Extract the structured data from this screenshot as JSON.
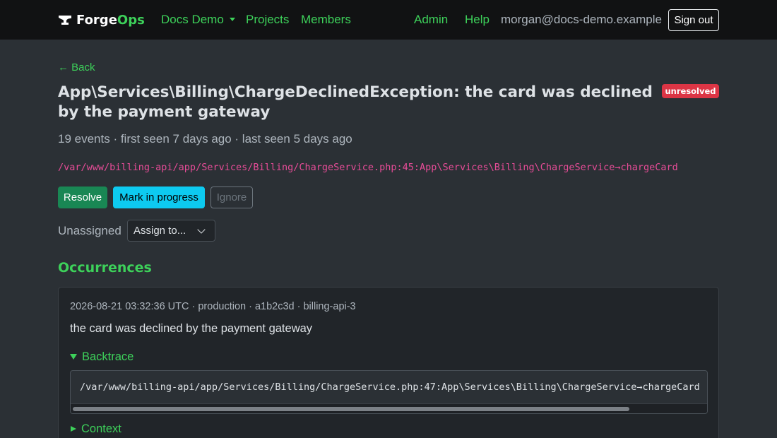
{
  "navbar": {
    "brand_part1": "Forge",
    "brand_part2": "Ops",
    "brand_icon": "anvil-icon",
    "org_menu": "Docs Demo",
    "projects": "Projects",
    "members": "Members",
    "admin": "Admin",
    "help": "Help",
    "user_email": "morgan@docs-demo.example",
    "sign_out": "Sign out"
  },
  "issue": {
    "back": "← Back",
    "title": "App\\Services\\Billing\\ChargeDeclinedException: the card was declined by the payment gateway",
    "status": "unresolved",
    "meta": "19 events · first seen 7 days ago · last seen 5 days ago",
    "location": "/var/www/billing-api/app/Services/Billing/ChargeService.php:45:App\\Services\\Billing\\ChargeService→chargeCard",
    "actions": {
      "resolve": "Resolve",
      "mark_in_progress": "Mark in progress",
      "ignore": "Ignore"
    },
    "assignee_label": "Unassigned",
    "assign_select": "Assign to..."
  },
  "occurrences": {
    "heading": "Occurrences",
    "items": [
      {
        "meta": "2026-08-21 03:32:36 UTC · production · a1b2c3d · billing-api-3",
        "message": "the card was declined by the payment gateway",
        "backtrace_label": "Backtrace",
        "backtrace_line": "/var/www/billing-api/app/Services/Billing/ChargeService.php:47:App\\Services\\Billing\\ChargeService→chargeCard",
        "backtrace_scroll_fraction": 0.88,
        "context_label": "Context"
      }
    ]
  },
  "colors": {
    "accent": "#3dd15a",
    "badge_danger": "#dc3545",
    "resolve": "#198754",
    "progress": "#0dcaf0",
    "location_pink": "#e64c97",
    "background": "#2b3035",
    "navbar": "#111213"
  }
}
